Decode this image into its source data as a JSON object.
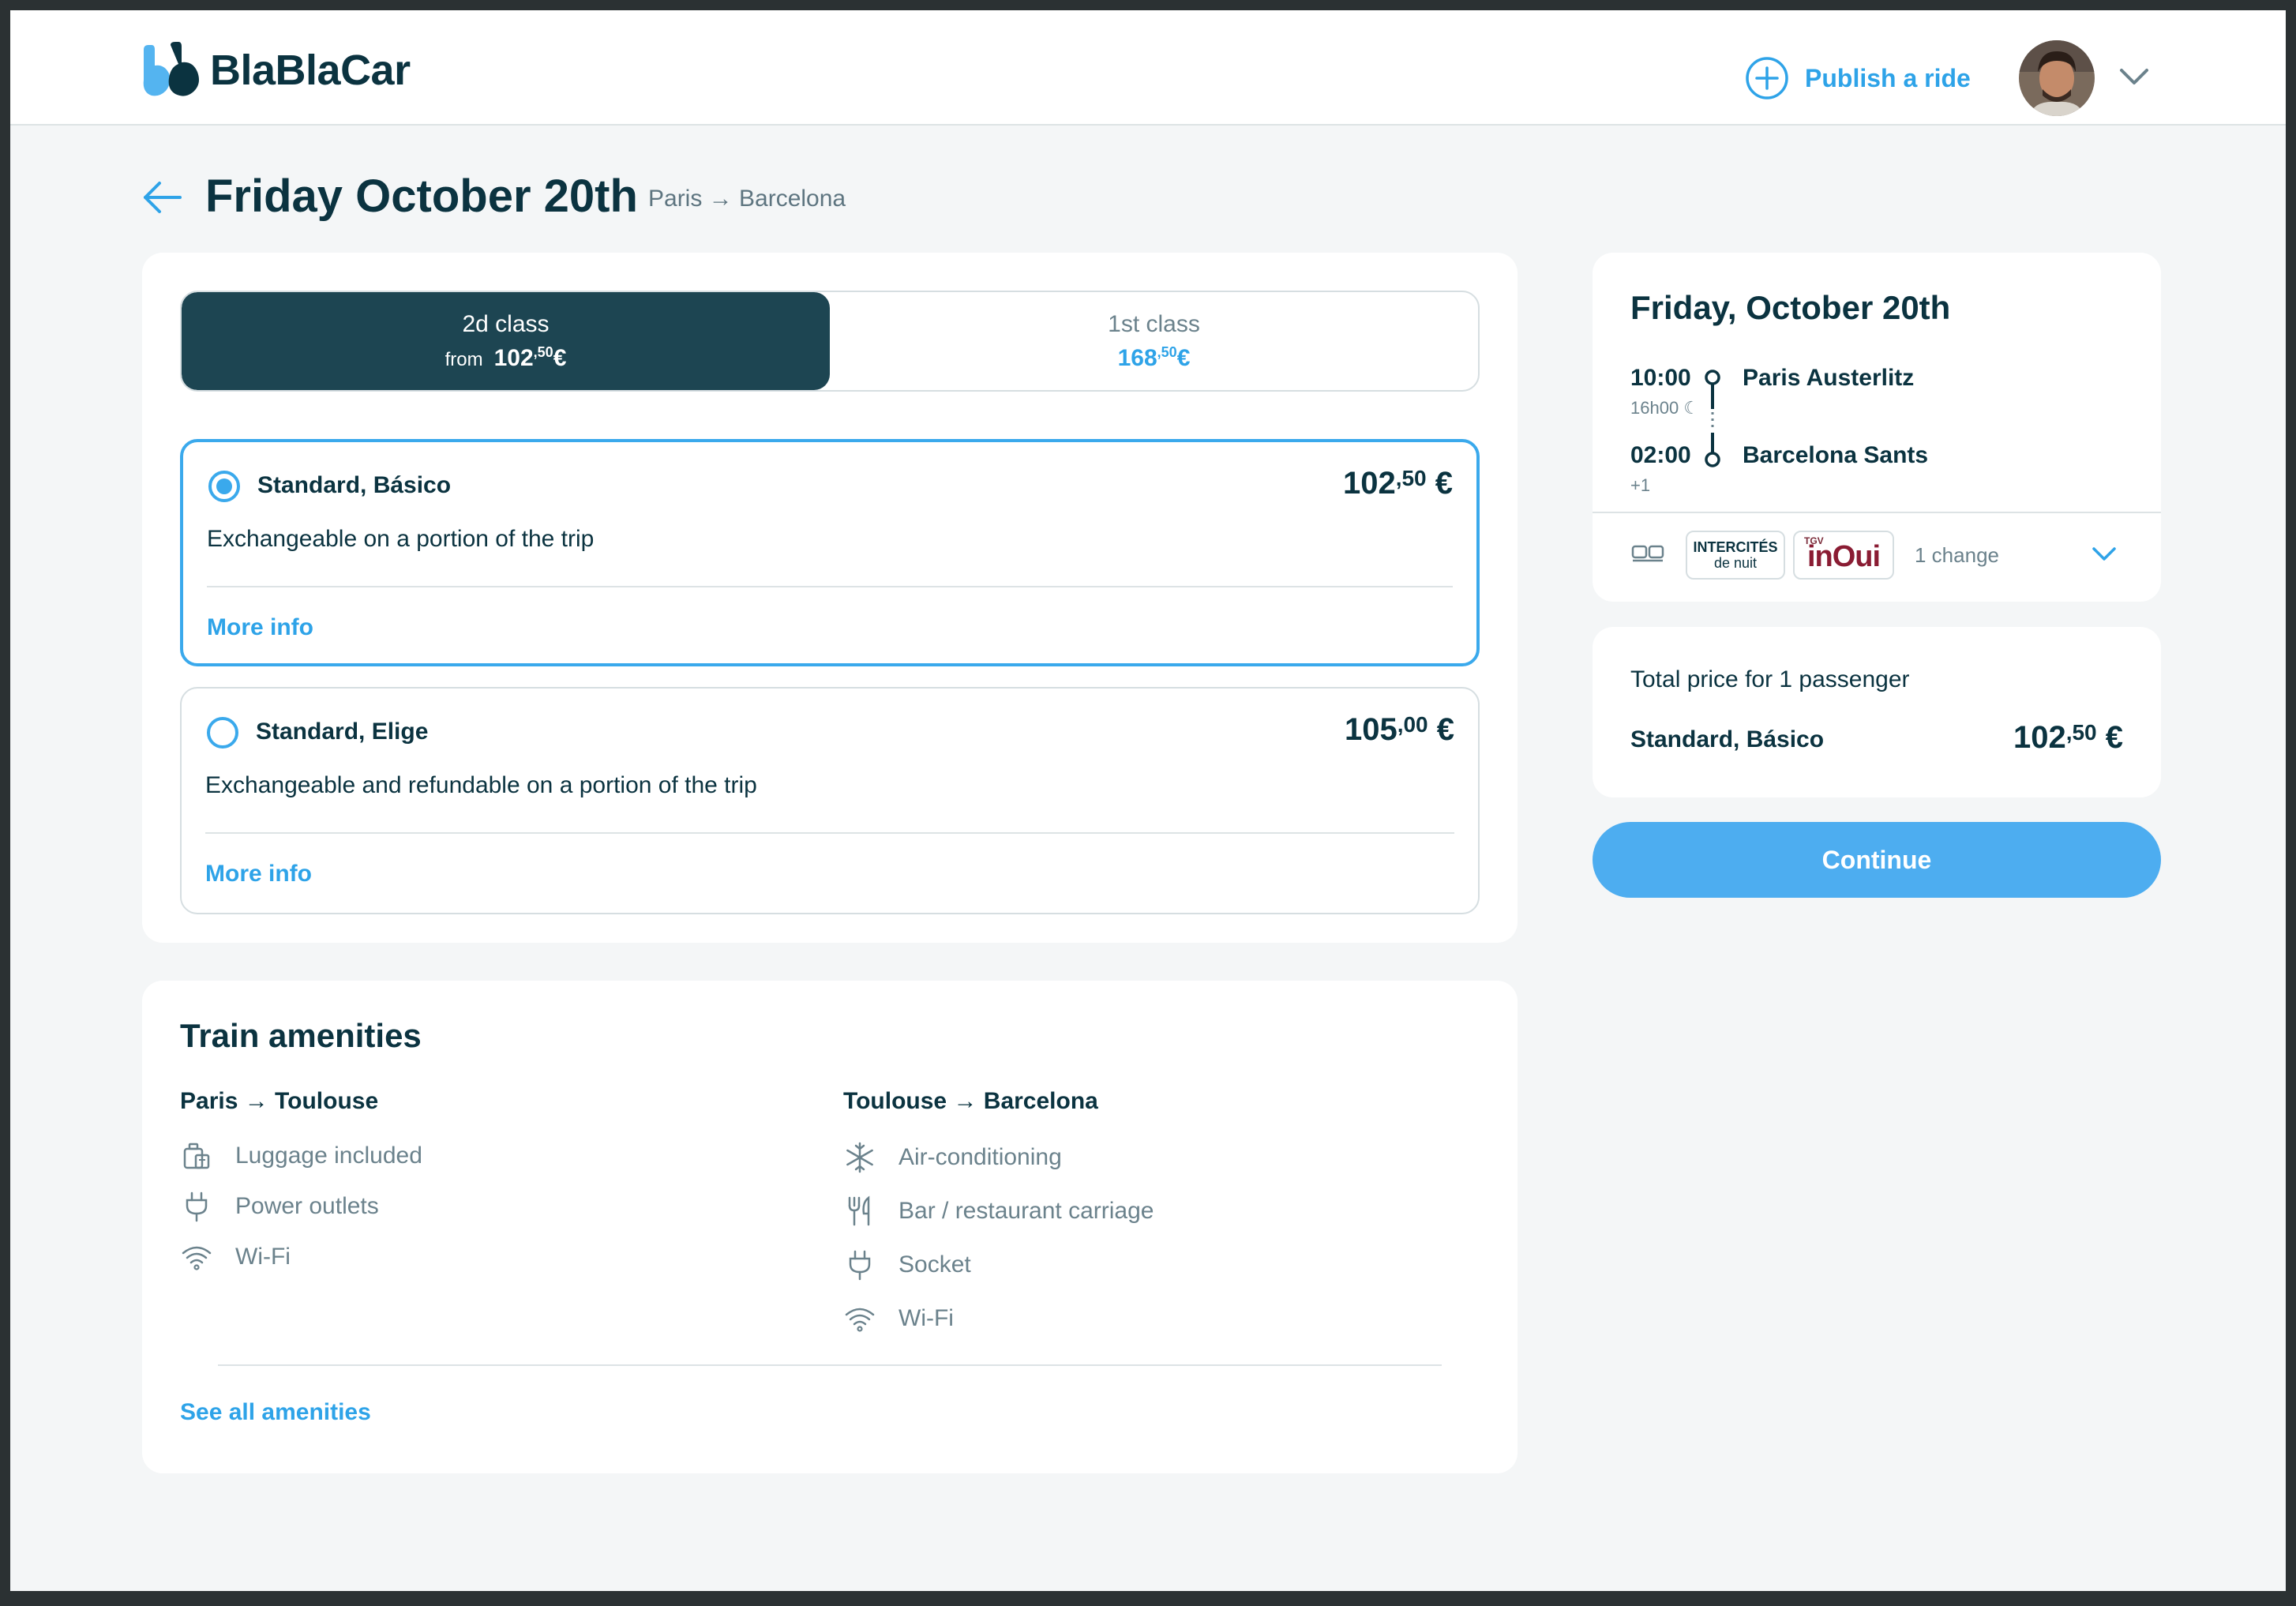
{
  "header": {
    "logo_text": "BlaBlaCar",
    "publish_label": "Publish a ride"
  },
  "page": {
    "title": "Friday October 20th",
    "route": "Paris → Barcelona"
  },
  "tabs": [
    {
      "label": "2d class",
      "from_label": "from",
      "price_main": "102",
      "price_sup": ",50",
      "currency": "€",
      "active": true
    },
    {
      "label": "1st class",
      "price_main": "168",
      "price_sup": ",50",
      "currency": "€",
      "active": false
    }
  ],
  "fares": [
    {
      "name": "Standard, Básico",
      "price_main": "102",
      "price_sup": ",50",
      "currency": " €",
      "description": "Exchangeable on a portion of the trip",
      "more_info": "More info",
      "selected": true
    },
    {
      "name": "Standard, Elige",
      "price_main": "105",
      "price_sup": ",00",
      "currency": " €",
      "description": "Exchangeable and refundable on a portion of the trip",
      "more_info": "More info",
      "selected": false
    }
  ],
  "amenities": {
    "title": "Train amenities",
    "segments": [
      {
        "route": "Paris → Toulouse",
        "items": [
          {
            "icon": "luggage-icon",
            "label": "Luggage included"
          },
          {
            "icon": "power-plug-icon",
            "label": "Power outlets"
          },
          {
            "icon": "wifi-icon",
            "label": "Wi-Fi"
          }
        ]
      },
      {
        "route": "Toulouse → Barcelona",
        "items": [
          {
            "icon": "snowflake-icon",
            "label": "Air-conditioning"
          },
          {
            "icon": "fork-knife-icon",
            "label": "Bar / restaurant carriage"
          },
          {
            "icon": "power-plug-icon",
            "label": "Socket"
          },
          {
            "icon": "wifi-icon",
            "label": "Wi-Fi"
          }
        ]
      }
    ],
    "see_all": "See all amenities"
  },
  "trip": {
    "date": "Friday, October 20th",
    "departure_time": "10:00",
    "duration": "16h00",
    "departure_station": "Paris Austerlitz",
    "arrival_time": "02:00",
    "day_offset": "+1",
    "arrival_station": "Barcelona Sants",
    "operator1_line1": "INTERCITÉS",
    "operator1_line2": "de nuit",
    "operator2_small": "TGV",
    "operator2": "inOui",
    "changes": "1 change"
  },
  "total": {
    "label": "Total price for 1 passenger",
    "fare_name": "Standard, Básico",
    "price_main": "102",
    "price_sup": ",50",
    "currency": " €"
  },
  "continue_label": "Continue",
  "colors": {
    "brand_dark": "#0b3340",
    "tab_active_bg": "#1d4552",
    "accent_blue": "#2ea3e8",
    "button_blue": "#4dadf0"
  }
}
